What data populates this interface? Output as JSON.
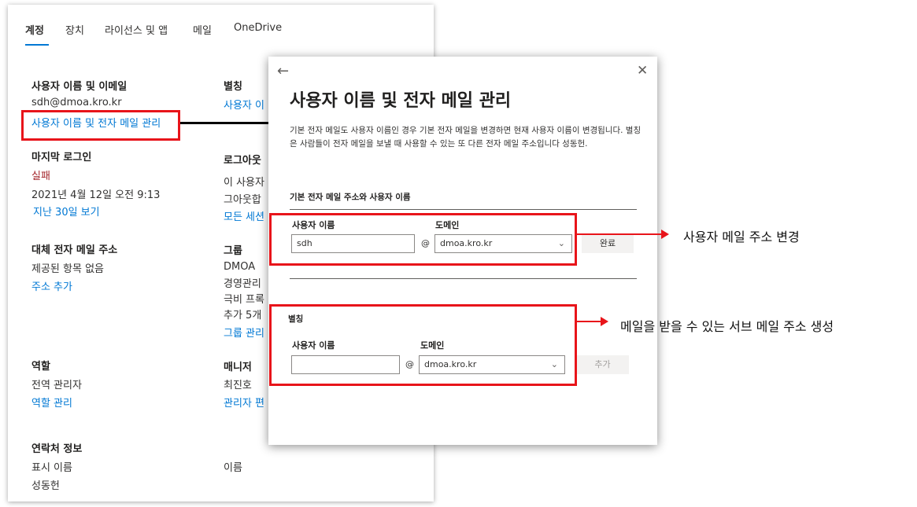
{
  "tabs": [
    "계정",
    "장치",
    "라이선스 및 앱",
    "메일",
    "OneDrive"
  ],
  "account": {
    "username_email": {
      "heading": "사용자 이름 및 이메일",
      "value": "sdh@dmoa.kro.kr",
      "manage_link": "사용자 이름 및 전자 메일 관리"
    },
    "alias": {
      "heading": "별칭",
      "link": "사용자 이"
    },
    "last_signin": {
      "heading": "마지막 로그인",
      "status": "실패",
      "datetime": "2021년 4월 12일 오전 9:13",
      "view_link": "지난 30일 보기"
    },
    "signout": {
      "heading": "로그아웃",
      "line1": "이 사용자",
      "line2": "그아웃합",
      "link": "모든 세션"
    },
    "alt_email": {
      "heading": "대체 전자 메일 주소",
      "value": "제공된 항목 없음",
      "link": "주소 추가"
    },
    "groups": {
      "heading": "그룹",
      "items": [
        "DMOA",
        "경영관리",
        "극비 프록",
        "추가 5개"
      ],
      "link": "그룹 관리"
    },
    "roles": {
      "heading": "역할",
      "value": "전역 관리자",
      "link": "역할 관리"
    },
    "manager": {
      "heading": "매니저",
      "value": "최진호",
      "link": "관리자 편"
    },
    "contact": {
      "heading": "연락처 정보",
      "display_name_label": "표시 이름",
      "display_name_value": "성동헌",
      "name_label": "이름"
    }
  },
  "dialog": {
    "title": "사용자 이름 및 전자 메일 관리",
    "description": "기본 전자 메일도 사용자 이름인 경우 기본 전자 메일을 변경하면 현재 사용자 이름이 변경됩니다. 별칭은 사람들이 전자 메일을 보낼 때 사용할 수 있는 또 다른 전자 메일 주소입니다 성동헌.",
    "primary_section_title": "기본 전자 메일 주소와 사용자 이름",
    "username_label": "사용자 이름",
    "domain_label": "도메인",
    "username_value": "sdh",
    "at_sign": "@",
    "domain_value": "dmoa.kro.kr",
    "done_button": "완료",
    "alias_section_title": "별칭",
    "alias_username_label": "사용자 이름",
    "alias_domain_label": "도메인",
    "alias_username_value": "",
    "alias_domain_value": "dmoa.kro.kr",
    "add_button": "추가",
    "back_icon": "←",
    "close_icon": "✕"
  },
  "annotations": {
    "callout_1": "사용자 메일 주소 변경",
    "callout_2": "메일을 받을 수 있는 서브 메일 주소 생성"
  },
  "colors": {
    "accent": "#0078d4",
    "annotation_red": "#e8141a",
    "error": "#a4262c"
  }
}
